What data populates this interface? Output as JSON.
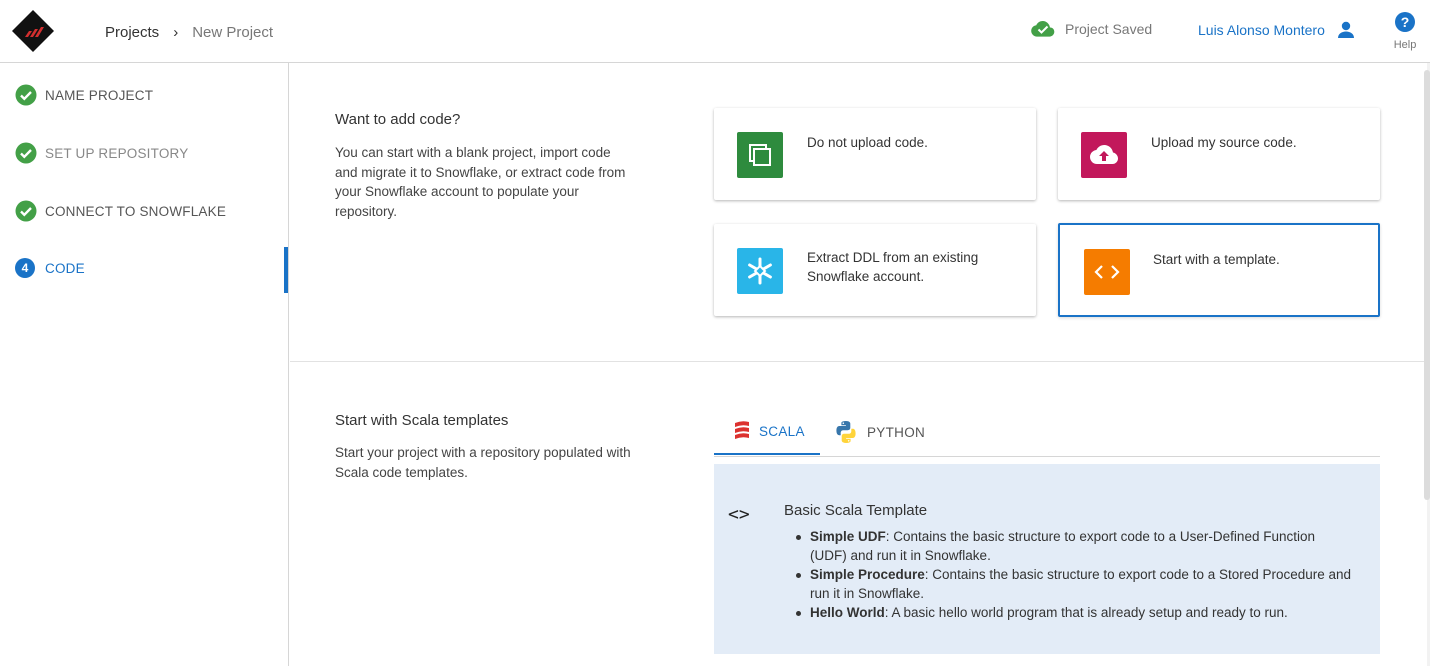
{
  "header": {
    "breadcrumb": [
      "Projects",
      "New Project"
    ],
    "separator": "›",
    "status_text": "Project Saved",
    "user_name": "Luis Alonso Montero",
    "help_label": "Help"
  },
  "sidebar": {
    "steps": [
      {
        "label": "NAME PROJECT",
        "state": "complete"
      },
      {
        "label": "SET UP REPOSITORY",
        "state": "complete"
      },
      {
        "label": "CONNECT TO SNOWFLAKE",
        "state": "complete"
      },
      {
        "label": "CODE",
        "state": "active",
        "number": "4"
      }
    ]
  },
  "add_code": {
    "title": "Want to add code?",
    "description": "You can start with a blank project, import code and migrate it to Snowflake, or extract code from your Snowflake account to populate your repository.",
    "options": [
      {
        "label": "Do not upload code.",
        "icon": "copy-icon",
        "color": "#2e8b3e"
      },
      {
        "label": "Upload my source code.",
        "icon": "cloud-upload-icon",
        "color": "#c2185b"
      },
      {
        "label": "Extract DDL from an existing Snowflake account.",
        "icon": "snowflake-icon",
        "color": "#29b5e8"
      },
      {
        "label": "Start with a template.",
        "icon": "code-icon",
        "color": "#f57c00",
        "selected": true
      }
    ]
  },
  "templates": {
    "title": "Start with Scala templates",
    "description": "Start your project with a repository populated with Scala code templates.",
    "tabs": [
      {
        "label": "SCALA",
        "icon": "scala-icon",
        "active": true
      },
      {
        "label": "PYTHON",
        "icon": "python-icon",
        "active": false
      }
    ],
    "template": {
      "icon": "<>",
      "title": "Basic Scala Template",
      "items": [
        {
          "name": "Simple UDF",
          "text": ": Contains the basic structure to export code to a User-Defined Function (UDF) and run it in Snowflake."
        },
        {
          "name": "Simple Procedure",
          "text": ": Contains the basic structure to export code to a Stored Procedure and run it in Snowflake."
        },
        {
          "name": "Hello World",
          "text": ": A basic hello world program that is already setup and ready to run."
        }
      ]
    }
  },
  "colors": {
    "accent": "#1a73c7",
    "success": "#43a047",
    "template_bg": "#e3ecf7"
  }
}
